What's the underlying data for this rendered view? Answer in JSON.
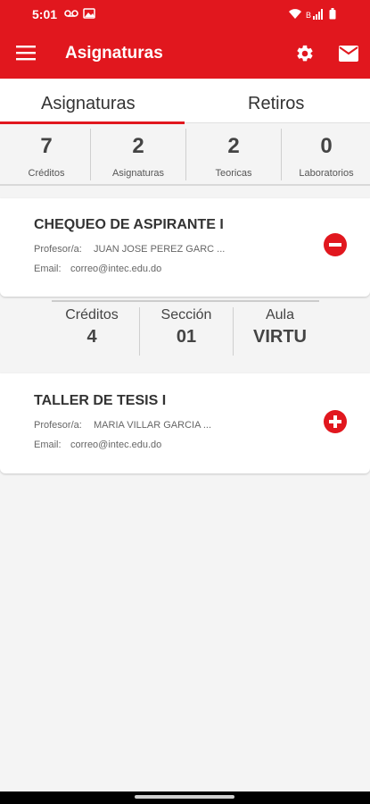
{
  "status_bar": {
    "time": "5:01",
    "left_icons": [
      "voicemail-icon",
      "image-icon"
    ],
    "right_icons": [
      "wifi-icon",
      "signal-icon",
      "battery-icon"
    ]
  },
  "app_bar": {
    "title": "Asignaturas",
    "menu_icon": "hamburger-menu-icon",
    "settings_icon": "gear-icon",
    "mail_icon": "mail-icon",
    "color": "#e1171e"
  },
  "tabs": [
    {
      "label": "Asignaturas",
      "selected": true
    },
    {
      "label": "Retiros",
      "selected": false
    }
  ],
  "stats": [
    {
      "value": "7",
      "label": "Créditos"
    },
    {
      "value": "2",
      "label": "Asignaturas"
    },
    {
      "value": "2",
      "label": "Teoricas"
    },
    {
      "value": "0",
      "label": "Laboratorios"
    }
  ],
  "courses": [
    {
      "name": "CHEQUEO DE ASPIRANTE I",
      "professor_label": "Profesor/a:",
      "professor": "JUAN JOSE PEREZ GARC ...",
      "email_label": "Email:",
      "email": "correo@intec.edu.do",
      "action_icon": "minus-circle-icon",
      "expanded": true,
      "details": [
        {
          "label": "Créditos",
          "value": "4"
        },
        {
          "label": "Sección",
          "value": "01"
        },
        {
          "label": "Aula",
          "value": "VIRTU"
        }
      ]
    },
    {
      "name": "TALLER DE TESIS I",
      "professor_label": "Profesor/a:",
      "professor": "MARIA VILLAR GARCIA ...",
      "email_label": "Email:",
      "email": "correo@intec.edu.do",
      "action_icon": "plus-circle-icon",
      "expanded": false
    }
  ]
}
